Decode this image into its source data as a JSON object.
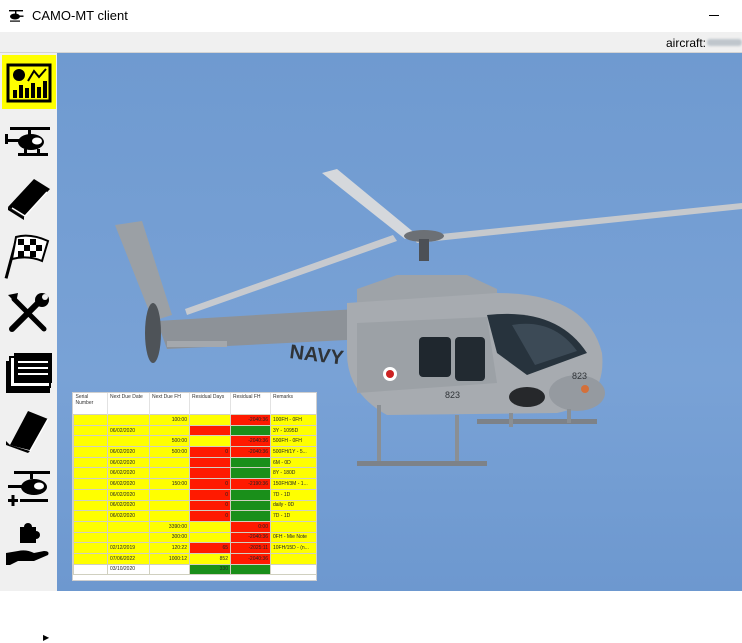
{
  "window": {
    "title": "CAMO-MT client"
  },
  "header": {
    "aircraft_label": "aircraft:"
  },
  "sidebar": {
    "items": [
      {
        "icon": "dashboard-chart-icon",
        "active": true
      },
      {
        "icon": "helicopter-icon",
        "active": false
      },
      {
        "icon": "book-icon",
        "active": false
      },
      {
        "icon": "checkered-flag-icon",
        "active": false
      },
      {
        "icon": "tools-icon",
        "active": false
      },
      {
        "icon": "folder-icon",
        "active": false
      },
      {
        "icon": "manuals-icon",
        "active": false
      },
      {
        "icon": "helicopter-add-icon",
        "active": false
      },
      {
        "icon": "hand-puzzle-icon",
        "active": false
      }
    ]
  },
  "aircraft_photo": {
    "marking_text": "NAVY",
    "tail_number": "823"
  },
  "status_grid": {
    "headers": [
      "Serial Number",
      "Next Due Date",
      "Next Due FH",
      "Residual Days",
      "Residual FH",
      "Remarks"
    ],
    "rows": [
      {
        "cells": [
          "",
          "",
          "100:00",
          "",
          "-2040:36",
          "100FH - 0FH"
        ],
        "colors": [
          "y",
          "y",
          "y",
          "y",
          "r",
          "y"
        ]
      },
      {
        "cells": [
          "",
          "06/02/2020",
          "",
          "",
          "",
          "3Y - 1095D"
        ],
        "colors": [
          "y",
          "y",
          "y",
          "r",
          "g",
          "y"
        ]
      },
      {
        "cells": [
          "",
          "",
          "500:00",
          "",
          "-2040:36",
          "500FH - 0FH"
        ],
        "colors": [
          "y",
          "y",
          "y",
          "y",
          "r",
          "y"
        ]
      },
      {
        "cells": [
          "",
          "06/02/2020",
          "500:00",
          "0",
          "-2040:36",
          "500FH/1Y - 5..."
        ],
        "colors": [
          "y",
          "y",
          "y",
          "r",
          "r",
          "y"
        ]
      },
      {
        "cells": [
          "",
          "06/02/2020",
          "",
          "",
          "",
          "6M - 0D"
        ],
        "colors": [
          "y",
          "y",
          "y",
          "r",
          "g",
          "y"
        ]
      },
      {
        "cells": [
          "",
          "06/02/2020",
          "",
          "",
          "",
          "8Y - 180D"
        ],
        "colors": [
          "y",
          "y",
          "y",
          "r",
          "g",
          "y"
        ]
      },
      {
        "cells": [
          "",
          "06/02/2020",
          "150:00",
          "0",
          "-2190:36",
          "150FH/3M - 1..."
        ],
        "colors": [
          "y",
          "y",
          "y",
          "r",
          "r",
          "y"
        ]
      },
      {
        "cells": [
          "",
          "06/02/2020",
          "",
          "0",
          "",
          "7D - 1D"
        ],
        "colors": [
          "y",
          "y",
          "y",
          "r",
          "g",
          "y"
        ]
      },
      {
        "cells": [
          "",
          "06/02/2020",
          "",
          "0",
          "",
          "daily - 0D"
        ],
        "colors": [
          "y",
          "y",
          "y",
          "r",
          "g",
          "y"
        ]
      },
      {
        "cells": [
          "",
          "06/02/2020",
          "",
          "0",
          "",
          "7D - 1D"
        ],
        "colors": [
          "y",
          "y",
          "y",
          "r",
          "g",
          "y"
        ]
      },
      {
        "cells": [
          "",
          "",
          "3390:00",
          "",
          "0:00",
          ""
        ],
        "colors": [
          "y",
          "y",
          "y",
          "y",
          "r",
          "y"
        ]
      },
      {
        "cells": [
          "",
          "",
          "300:00",
          "",
          "-2040:36",
          "0FH - Mie Note"
        ],
        "colors": [
          "y",
          "y",
          "y",
          "y",
          "r",
          "y"
        ]
      },
      {
        "cells": [
          "",
          "02/12/2019",
          "120:22",
          "65",
          "-2025:11",
          "10FH/15D - (n..."
        ],
        "colors": [
          "y",
          "y",
          "y",
          "r",
          "r",
          "y"
        ]
      },
      {
        "cells": [
          "",
          "07/06/2022",
          "1000:12",
          "852",
          "-2040:36",
          ""
        ],
        "colors": [
          "y",
          "y",
          "y",
          "y",
          "r",
          "y"
        ]
      },
      {
        "cells": [
          "",
          "03/10/2020",
          "",
          "330",
          "",
          ""
        ],
        "colors": [
          "w",
          "w",
          "w",
          "g",
          "g",
          "w"
        ]
      }
    ]
  },
  "colors": {
    "yellow": "#ffff00",
    "red": "#ff1a00",
    "green": "#1a8f1a",
    "sky": "#739ed3",
    "active_nav": "#ffff00"
  }
}
